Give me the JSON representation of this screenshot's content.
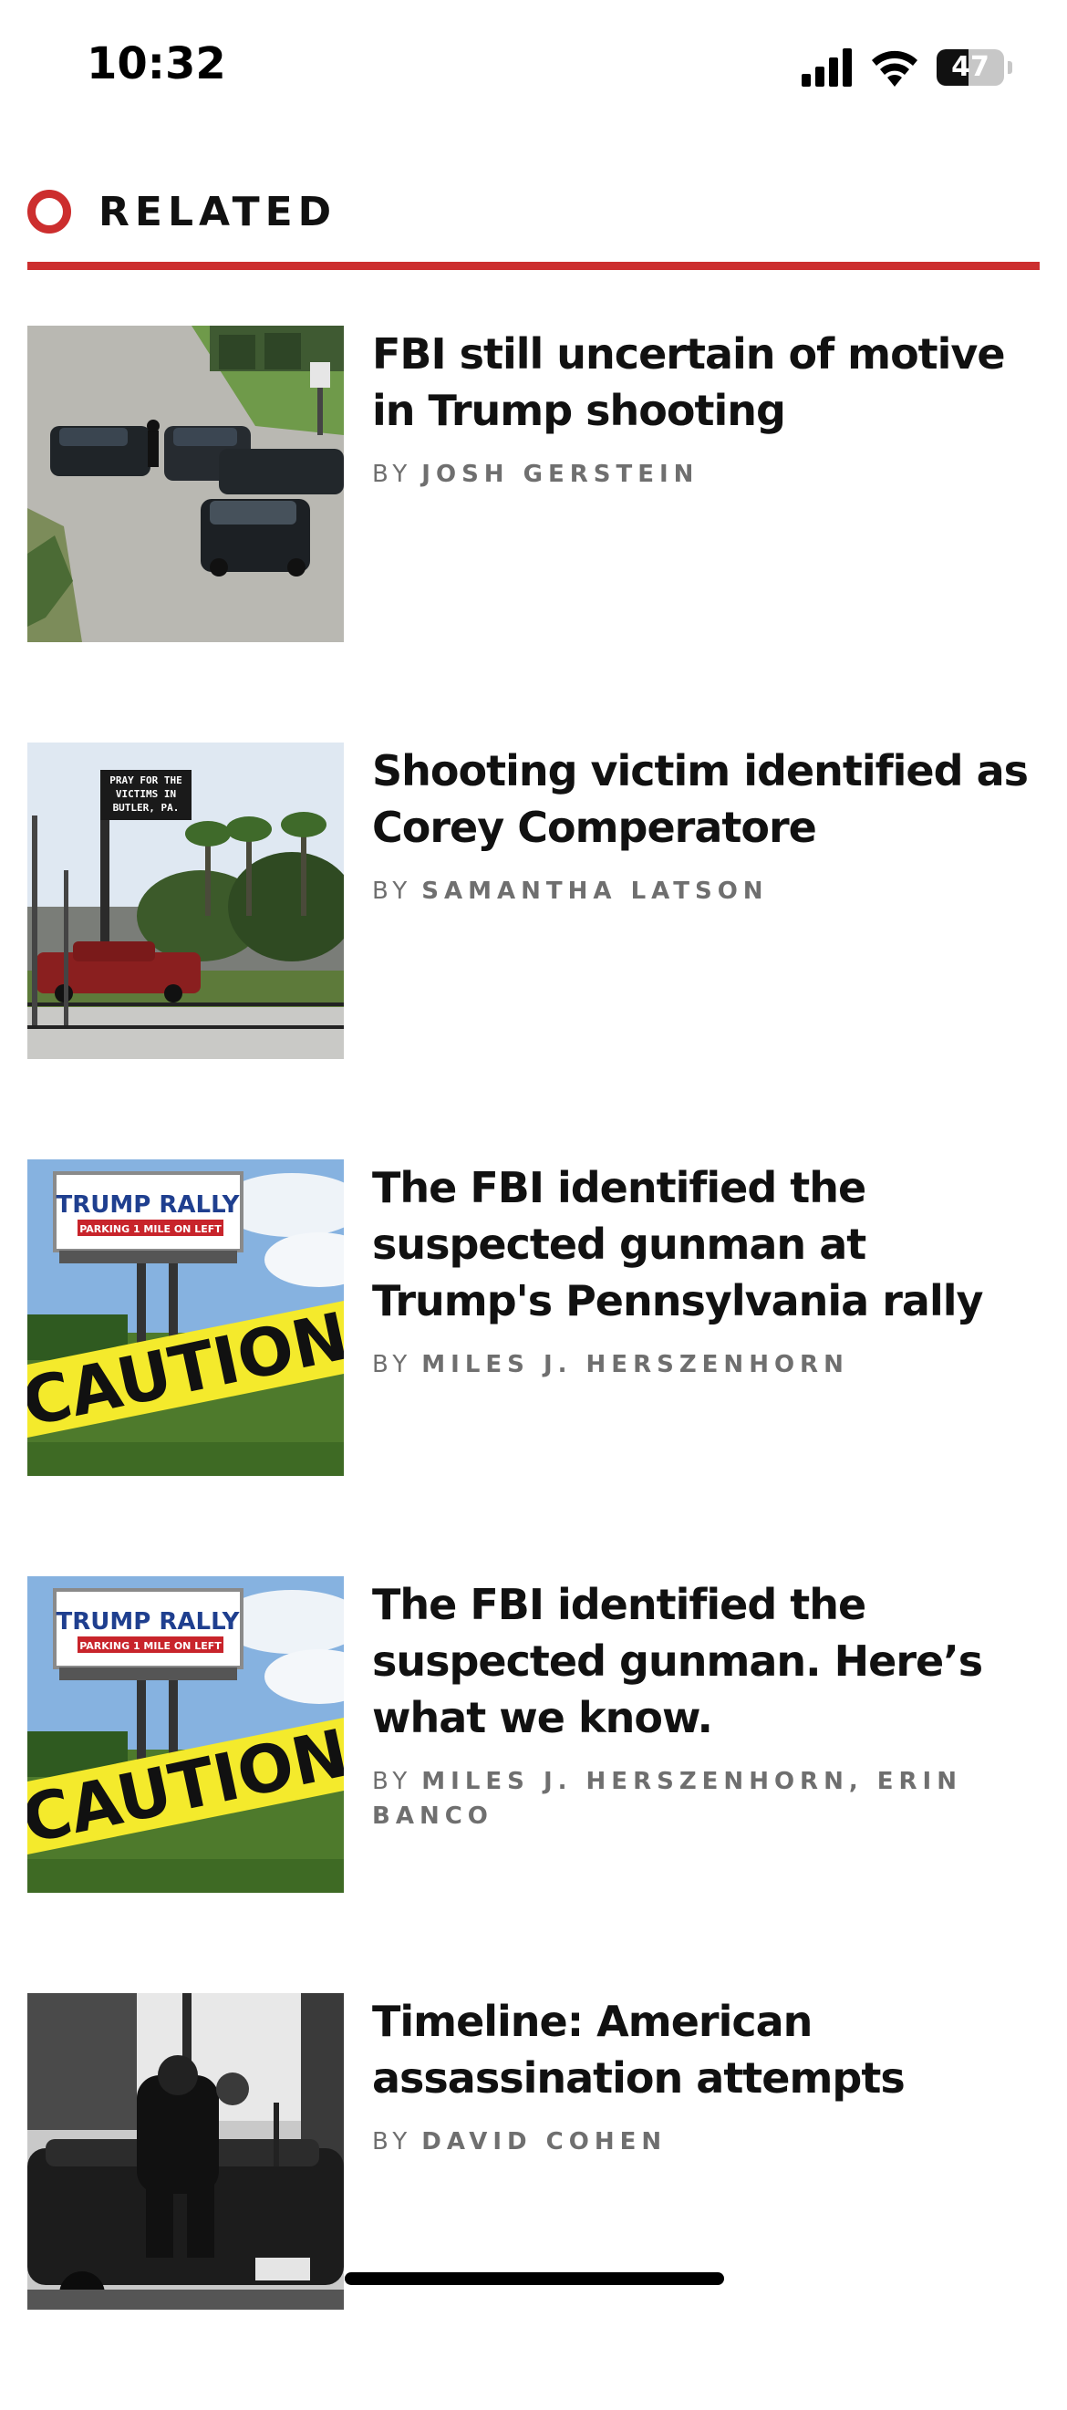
{
  "status_bar": {
    "time": "10:32",
    "battery_level": "47",
    "icons": [
      "signal-icon",
      "wifi-icon",
      "battery-icon"
    ]
  },
  "section": {
    "title": "RELATED",
    "accent_color": "#cc2e2e"
  },
  "articles": [
    {
      "headline": "FBI still uncertain of motive in Trump shooting",
      "byline_prefix": "BY",
      "authors": "JOSH GERSTEIN",
      "image": "police-vehicles-photo"
    },
    {
      "headline": "Shooting victim identified as Corey Comperatore",
      "byline_prefix": "BY",
      "authors": "SAMANTHA LATSON",
      "image": "roadside-sign-photo",
      "image_sign_text": "PRAY FOR THE VICTIMS IN BUTLER, PA."
    },
    {
      "headline": "The FBI identified the suspected gunman at Trump's Pennsylvania rally",
      "byline_prefix": "BY",
      "authors": "MILES J. HERSZENHORN",
      "image": "caution-tape-billboard-photo",
      "image_billboard_text": "TRUMP RALLY",
      "image_billboard_subtext": "PARKING 1 MILE ON LEFT",
      "image_tape_text": "CAUTION"
    },
    {
      "headline": "The FBI identified the suspected gunman. Here’s what we know.",
      "byline_prefix": "BY",
      "authors": "MILES J. HERSZENHORN, ERIN BANCO",
      "image": "caution-tape-billboard-photo",
      "image_billboard_text": "TRUMP RALLY",
      "image_billboard_subtext": "PARKING 1 MILE ON LEFT",
      "image_tape_text": "CAUTION"
    },
    {
      "headline": "Timeline: American assassination attempts",
      "byline_prefix": "BY",
      "authors": "DAVID COHEN",
      "image": "historic-motorcade-photo"
    }
  ]
}
